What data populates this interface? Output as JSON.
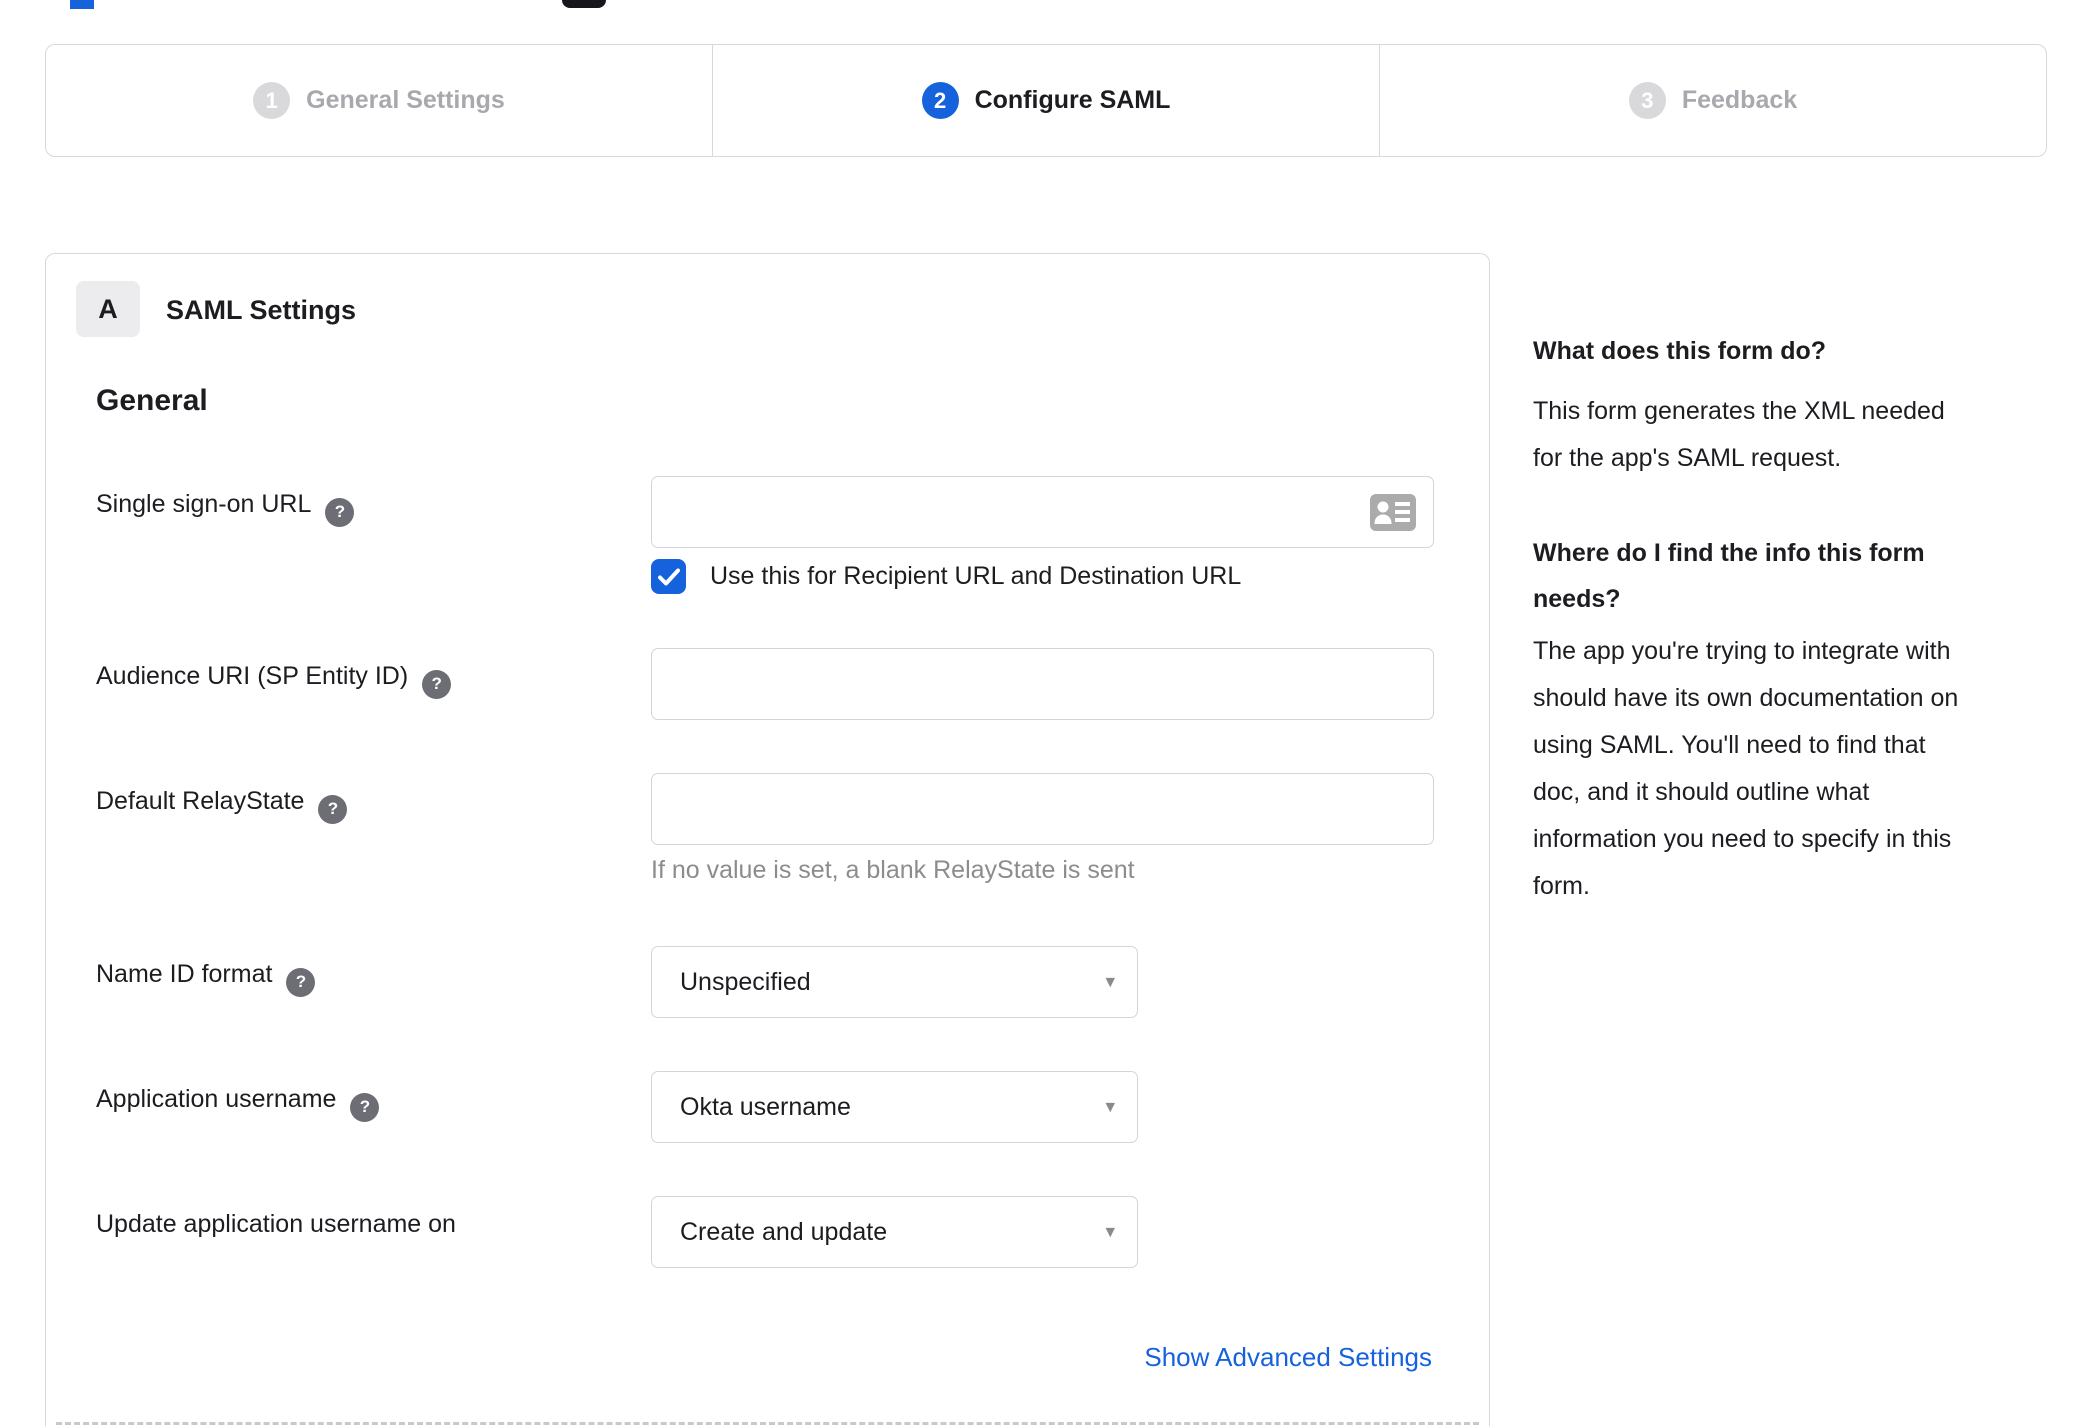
{
  "colors": {
    "accent_blue": "#1662dd",
    "text_dark": "#1d1d21",
    "inactive_gray": "#a8a8ae",
    "border_gray": "#d8d8d8",
    "hint_gray": "#8c8c8f"
  },
  "icons": {
    "help_glyph": "?",
    "caret_glyph": "▾"
  },
  "stepper": {
    "steps": [
      {
        "number": "1",
        "label": "General Settings",
        "state": "inactive"
      },
      {
        "number": "2",
        "label": "Configure SAML",
        "state": "active"
      },
      {
        "number": "3",
        "label": "Feedback",
        "state": "inactive"
      }
    ]
  },
  "panel": {
    "section_badge": "A",
    "section_title": "SAML Settings",
    "group_title": "General",
    "fields": [
      {
        "label": "Single sign-on URL",
        "has_help": true,
        "type": "text",
        "value": "",
        "checkbox_label": "Use this for Recipient URL and Destination URL",
        "checkbox_checked": true
      },
      {
        "label": "Audience URI (SP Entity ID)",
        "has_help": true,
        "type": "text",
        "value": ""
      },
      {
        "label": "Default RelayState",
        "has_help": true,
        "type": "text",
        "value": "",
        "hint": "If no value is set, a blank RelayState is sent"
      },
      {
        "label": "Name ID format",
        "has_help": true,
        "type": "select",
        "value": "Unspecified"
      },
      {
        "label": "Application username",
        "has_help": true,
        "type": "select",
        "value": "Okta username"
      },
      {
        "label": "Update application username on",
        "has_help": false,
        "type": "select",
        "value": "Create and update"
      }
    ],
    "advanced_link": "Show Advanced Settings"
  },
  "sidebar": {
    "q1": "What does this form do?",
    "a1": "This form generates the XML needed\nfor the app's SAML request.",
    "q2": "Where do I find the info this form\nneeds?",
    "a2": "The app you're trying to integrate with\nshould have its own documentation on\nusing SAML. You'll need to find that\ndoc, and it should outline what\ninformation you need to specify in this\nform."
  }
}
